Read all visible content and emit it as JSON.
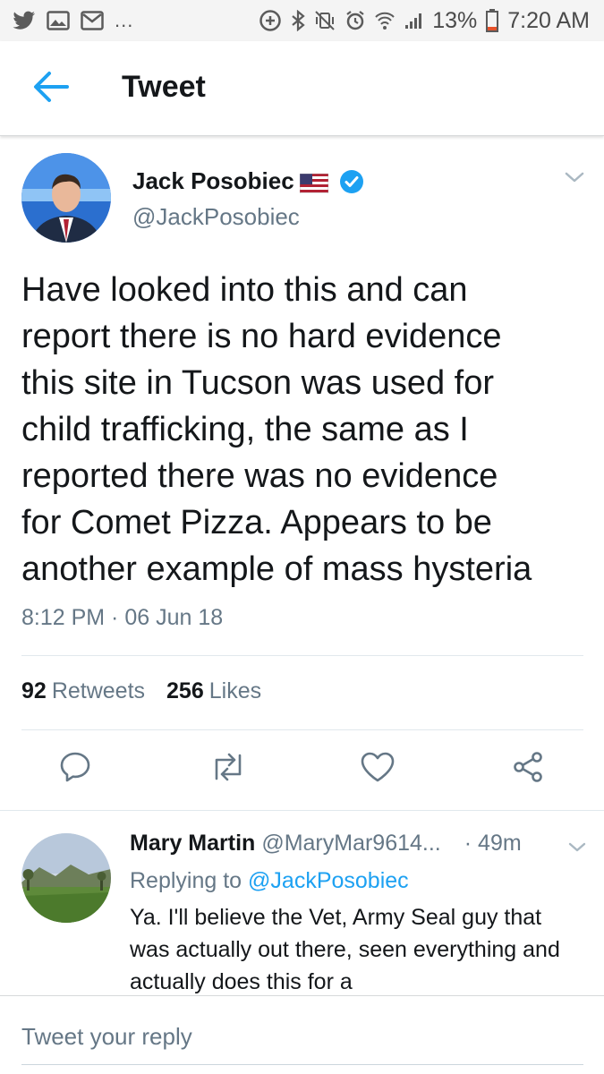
{
  "status_bar": {
    "left_icons": [
      "twitter-icon",
      "gallery-icon",
      "mail-icon",
      "more-dots-icon"
    ],
    "more_dots": "...",
    "right_icons": [
      "data-saver-icon",
      "bluetooth-icon",
      "vibrate-mute-icon",
      "alarm-icon",
      "wifi-icon",
      "signal-icon",
      "battery-icon"
    ],
    "battery": "13%",
    "time": "7:20 AM"
  },
  "header": {
    "title": "Tweet"
  },
  "tweet": {
    "author_name": "Jack Posobiec",
    "author_handle": "@JackPosobiec",
    "text": "Have looked into this and can\nreport there is no hard evidence\nthis site in Tucson was used for\nchild trafficking, the same as I\nreported there was no evidence\nfor Comet Pizza. Appears to be\nanother example of mass hysteria",
    "timestamp": "8:12 PM · 06 Jun 18",
    "retweets_count": "92",
    "retweets_label": "Retweets",
    "likes_count": "256",
    "likes_label": "Likes"
  },
  "reply": {
    "author_name": "Mary Martin",
    "author_handle": "@MaryMar9614...",
    "time": "· 49m",
    "replying_prefix": "Replying to",
    "replying_to": "@JackPosobiec",
    "text": "Ya. I'll believe the Vet, Army Seal guy that was actually out there, seen everything and actually does this for a"
  },
  "composer": {
    "placeholder": "Tweet your reply"
  },
  "colors": {
    "accent": "#1da1f2",
    "secondary_text": "#657786",
    "primary_text": "#14171a",
    "verified": "#1da1f2"
  }
}
